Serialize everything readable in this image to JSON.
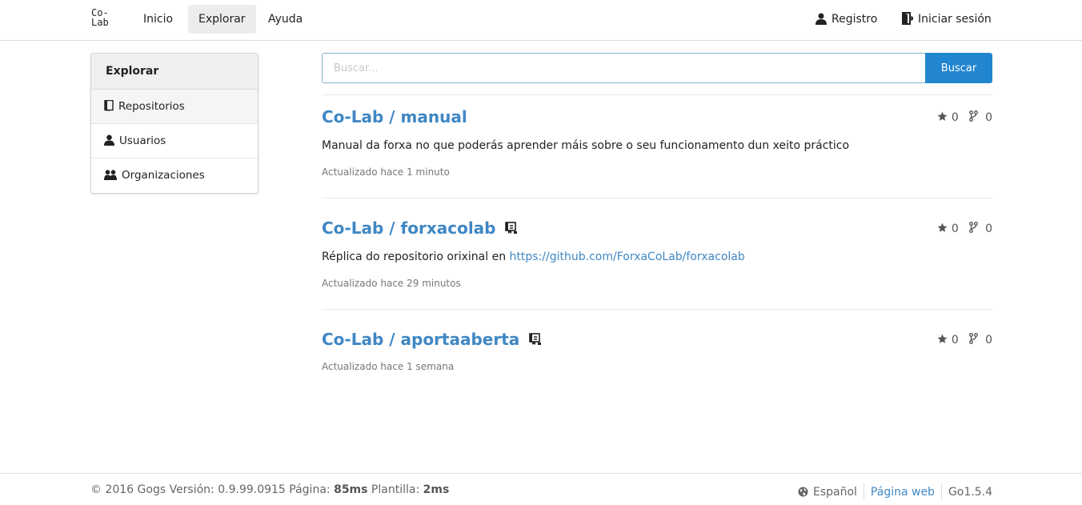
{
  "header": {
    "logo_line1": "Co-",
    "logo_line2": "Lab",
    "nav": [
      {
        "label": "Inicio"
      },
      {
        "label": "Explorar"
      },
      {
        "label": "Ayuda"
      }
    ],
    "register_label": "Registro",
    "login_label": "Iniciar sesión"
  },
  "sidebar": {
    "title": "Explorar",
    "items": [
      {
        "label": "Repositorios",
        "icon": "repo-icon"
      },
      {
        "label": "Usuarios",
        "icon": "person-icon"
      },
      {
        "label": "Organizaciones",
        "icon": "organization-icon"
      }
    ]
  },
  "search": {
    "placeholder": "Buscar...",
    "value": "",
    "button_label": "Buscar"
  },
  "repos": [
    {
      "owner": "Co-Lab",
      "sep": " / ",
      "name": "manual",
      "mirror": false,
      "stars": "0",
      "forks": "0",
      "description": "Manual da forxa no que poderás aprender máis sobre o seu funcionamento dun xeito práctico",
      "updated": "Actualizado hace 1 minuto"
    },
    {
      "owner": "Co-Lab",
      "sep": " / ",
      "name": "forxacolab",
      "mirror": true,
      "stars": "0",
      "forks": "0",
      "description_prefix": "Réplica do repositorio orixinal en ",
      "description_link": "https://github.com/ForxaCoLab/forxacolab",
      "updated": "Actualizado hace 29 minutos"
    },
    {
      "owner": "Co-Lab",
      "sep": " / ",
      "name": "aportaaberta",
      "mirror": true,
      "stars": "0",
      "forks": "0",
      "updated": "Actualizado hace 1 semana"
    }
  ],
  "footer": {
    "copyright": "© 2016 Gogs Versión: 0.9.99.0915 Página: ",
    "page_time": "85ms",
    "template_label": " Plantilla: ",
    "template_time": "2ms",
    "language": "Español",
    "website": "Página web",
    "go_version": "Go1.5.4"
  },
  "colors": {
    "link": "#3f87c4",
    "button": "#2185d0",
    "border": "#dddddd"
  }
}
